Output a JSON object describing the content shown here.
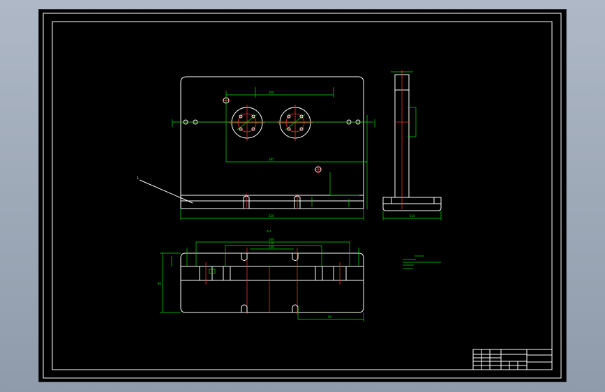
{
  "drawing": {
    "part_label": "1",
    "colors": {
      "outline": "#ffffff",
      "dimension": "#00e000",
      "centerline": "#ff2a2a",
      "background": "#000000",
      "app_background": "#9aa5b4"
    }
  }
}
